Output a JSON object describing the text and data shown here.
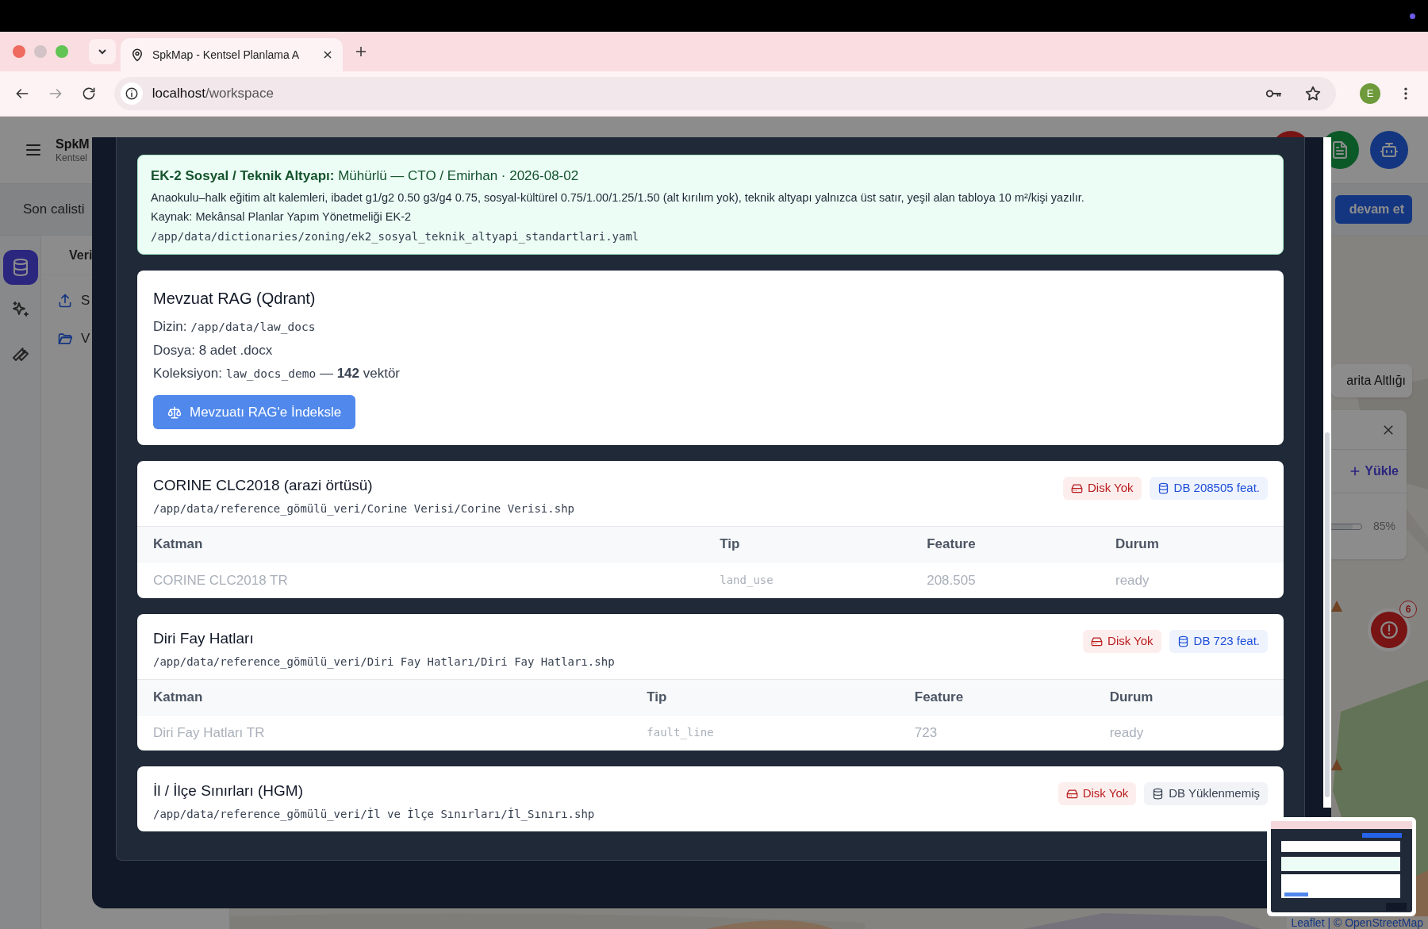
{
  "browser": {
    "tab_title": "SpkMap - Kentsel Planlama A",
    "url_host": "localhost",
    "url_path": "/workspace",
    "profile_initial": "E"
  },
  "app": {
    "brand": "SpkM",
    "subtitle": "Kentsel",
    "recent_label": "Son calisti",
    "continue_button": "devam et",
    "rail": [
      {
        "selected": true
      },
      {
        "selected": false
      },
      {
        "selected": false
      }
    ],
    "panel_title": "Veri",
    "panel_items": [
      {
        "label": "S"
      },
      {
        "label": "V"
      }
    ]
  },
  "map": {
    "layer_button": "arita Altlığı",
    "upload_button": "Yükle",
    "opacity": {
      "level": 0.85,
      "reading": "85%"
    },
    "alert_count": "6",
    "attribution": "Leaflet | © OpenStreetMap"
  },
  "modal": {
    "cards": [
      {
        "kind": "note",
        "title": "EK-2 Sosyal / Teknik Altyapı:",
        "status": "Mühürlü — CTO / Emirhan · 2026-08-02",
        "description": "Anaokulu–halk eğitim alt kalemleri, ibadet g1/g2 0.50 g3/g4 0.75, sosyal-kültürel 0.75/1.00/1.25/1.50 (alt kırılım yok), teknik altyapı yalnızca üst satır, yeşil alan tabloya 10 m²/kişi yazılır.",
        "source": "Kaynak: Mekânsal Planlar Yapım Yönetmeliği EK-2",
        "path": "/app/data/dictionaries/zoning/ek2_sosyal_teknik_altyapi_standartlari.yaml"
      },
      {
        "kind": "rag",
        "title": "Mevzuat RAG (Qdrant)",
        "lines": [
          {
            "label": "Dizin:",
            "code": "/app/data/law_docs"
          },
          {
            "label": "Dosya: 8 adet .docx"
          },
          {
            "label": "Koleksiyon:",
            "code": "law_docs_demo",
            "suffix": "— **142** vektör"
          }
        ],
        "button": "Mevzuatı RAG'e İndeksle"
      },
      {
        "kind": "dataset",
        "title": "CORINE CLC2018 (arazi örtüsü)",
        "path": "/app/data/reference_gömülü_veri/Corine Verisi/Corine Verisi.shp",
        "disk_badge": "Disk Yok",
        "db_badge": {
          "text": "DB 208505 feat.",
          "loaded": true
        },
        "table": {
          "columns": [
            "Katman",
            "Tip",
            "Feature",
            "Durum"
          ],
          "rows": [
            [
              "CORINE CLC2018 TR",
              "land_use",
              "208.505",
              "ready"
            ]
          ]
        }
      },
      {
        "kind": "dataset",
        "title": "Diri Fay Hatları",
        "path": "/app/data/reference_gömülü_veri/Diri Fay Hatları/Diri Fay Hatları.shp",
        "disk_badge": "Disk Yok",
        "db_badge": {
          "text": "DB 723 feat.",
          "loaded": true
        },
        "table": {
          "columns": [
            "Katman",
            "Tip",
            "Feature",
            "Durum"
          ],
          "rows": [
            [
              "Diri Fay Hatları TR",
              "fault_line",
              "723",
              "ready"
            ]
          ]
        }
      },
      {
        "kind": "dataset",
        "title": "İl / İlçe Sınırları (HGM)",
        "path": "/app/data/reference_gömülü_veri/İl ve İlçe Sınırları/İl_Sınırı.shp",
        "disk_badge": "Disk Yok",
        "db_badge": {
          "text": "DB Yüklenmemiş",
          "loaded": false
        }
      }
    ]
  }
}
